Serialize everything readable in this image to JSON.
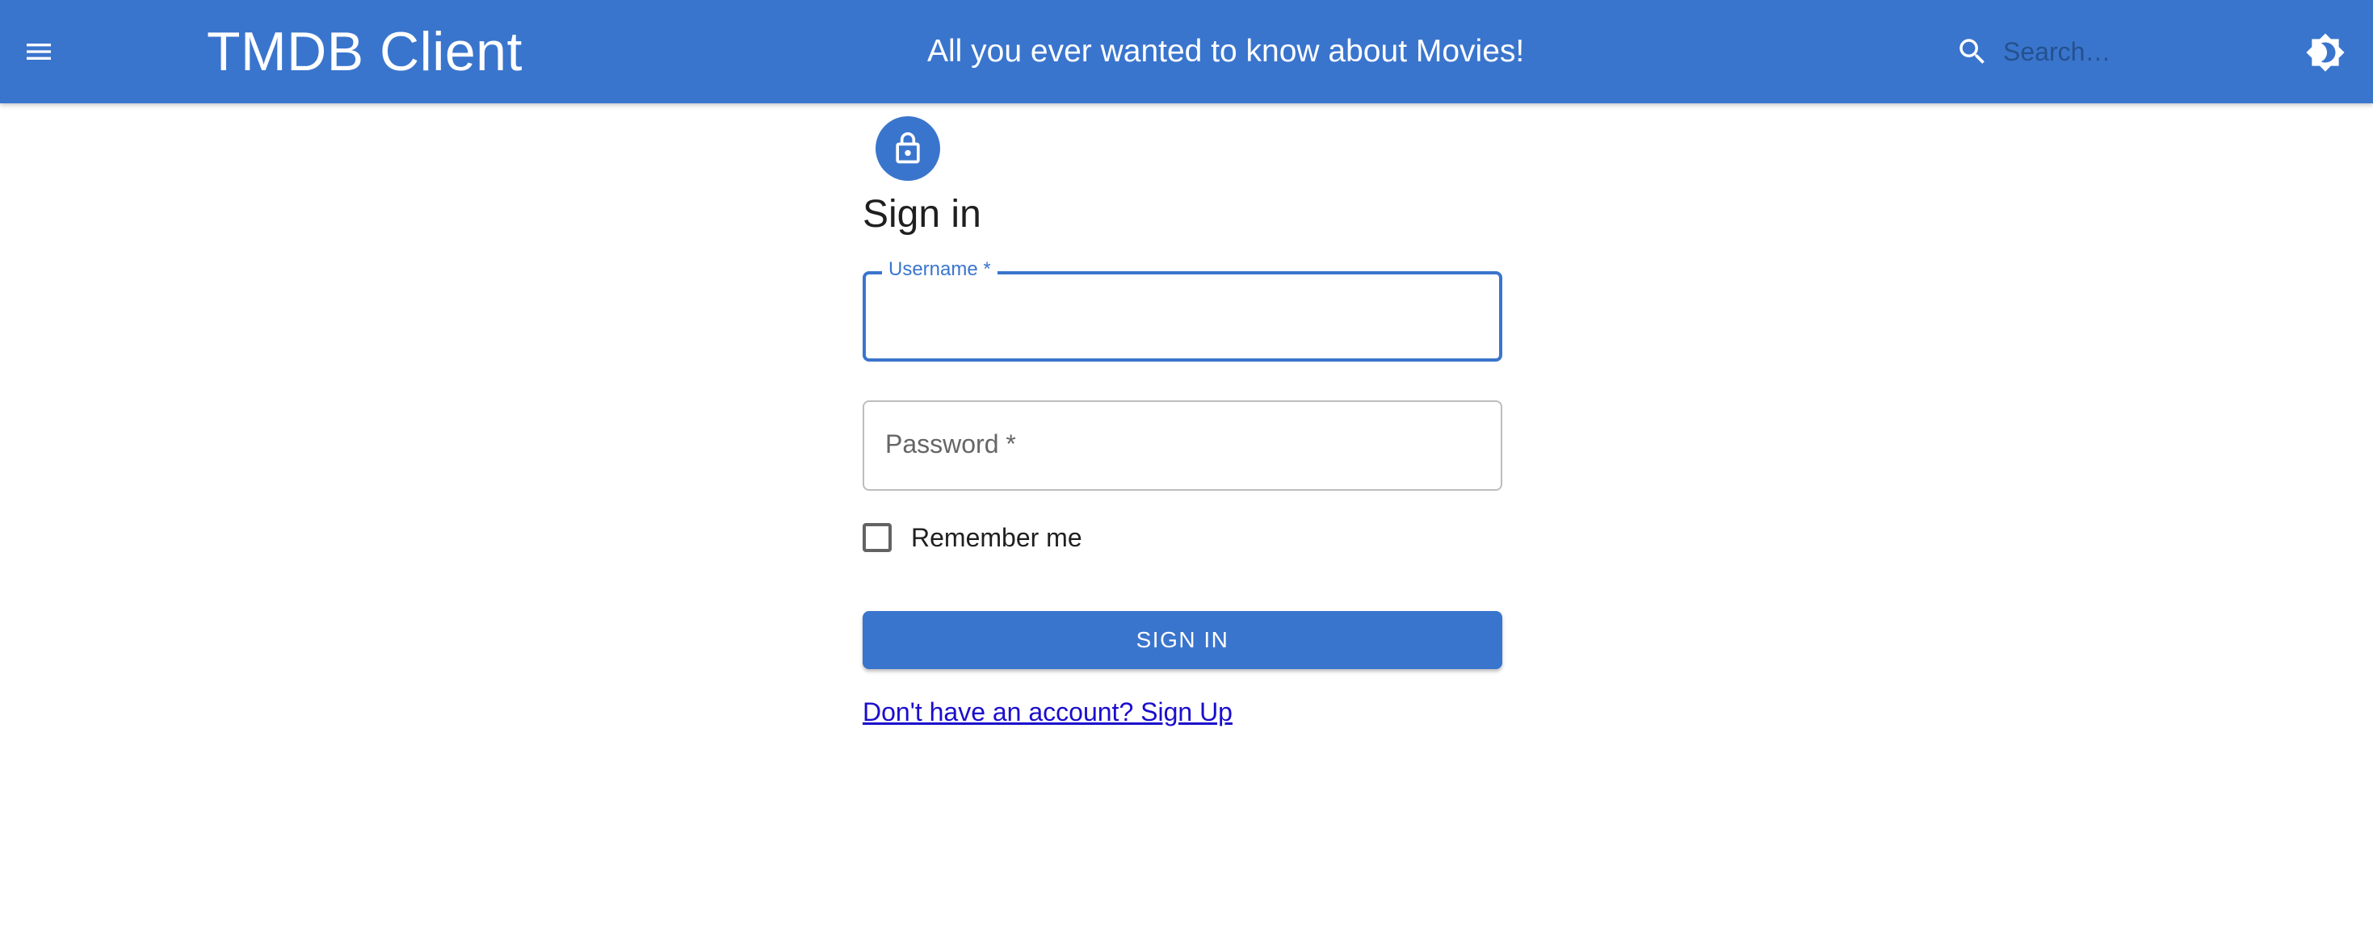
{
  "header": {
    "brand": "TMDB Client",
    "tagline": "All you ever wanted to know about Movies!",
    "search_placeholder": "Search…",
    "icons": {
      "menu": "menu-icon",
      "search": "search-icon",
      "theme": "brightness-icon"
    }
  },
  "form": {
    "avatar_icon": "lock-icon",
    "title": "Sign in",
    "username_label": "Username *",
    "username_value": "",
    "password_label": "Password *",
    "password_value": "",
    "remember_label": "Remember me",
    "remember_checked": false,
    "submit_label": "SIGN IN",
    "signup_link": "Don't have an account? Sign Up"
  },
  "colors": {
    "primary": "#3a75cd",
    "link": "#1a0dcc",
    "text": "#1f1f1f"
  }
}
